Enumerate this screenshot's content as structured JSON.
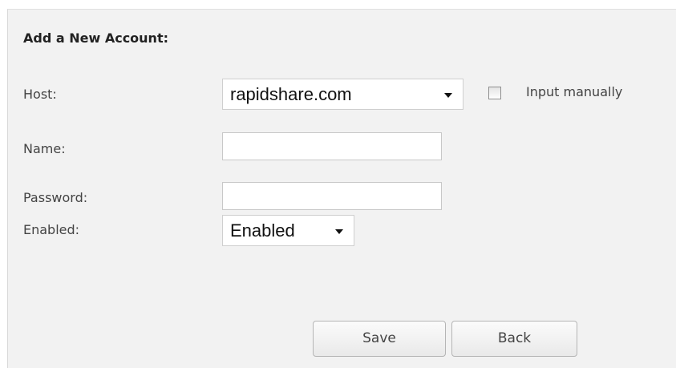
{
  "form": {
    "heading": "Add a New Account:",
    "host": {
      "label": "Host:",
      "selected": "rapidshare.com",
      "manual_checked": false,
      "manual_label": "Input manually"
    },
    "name": {
      "label": "Name:",
      "value": ""
    },
    "password": {
      "label": "Password:",
      "value": ""
    },
    "enabled": {
      "label": "Enabled:",
      "selected": "Enabled"
    },
    "buttons": {
      "save": "Save",
      "back": "Back"
    }
  },
  "colors": {
    "panel_background": "#f2f2f2",
    "field_background": "#ffffff",
    "text": "#444444"
  },
  "icons": {
    "dropdown": "chevron-down-icon"
  }
}
